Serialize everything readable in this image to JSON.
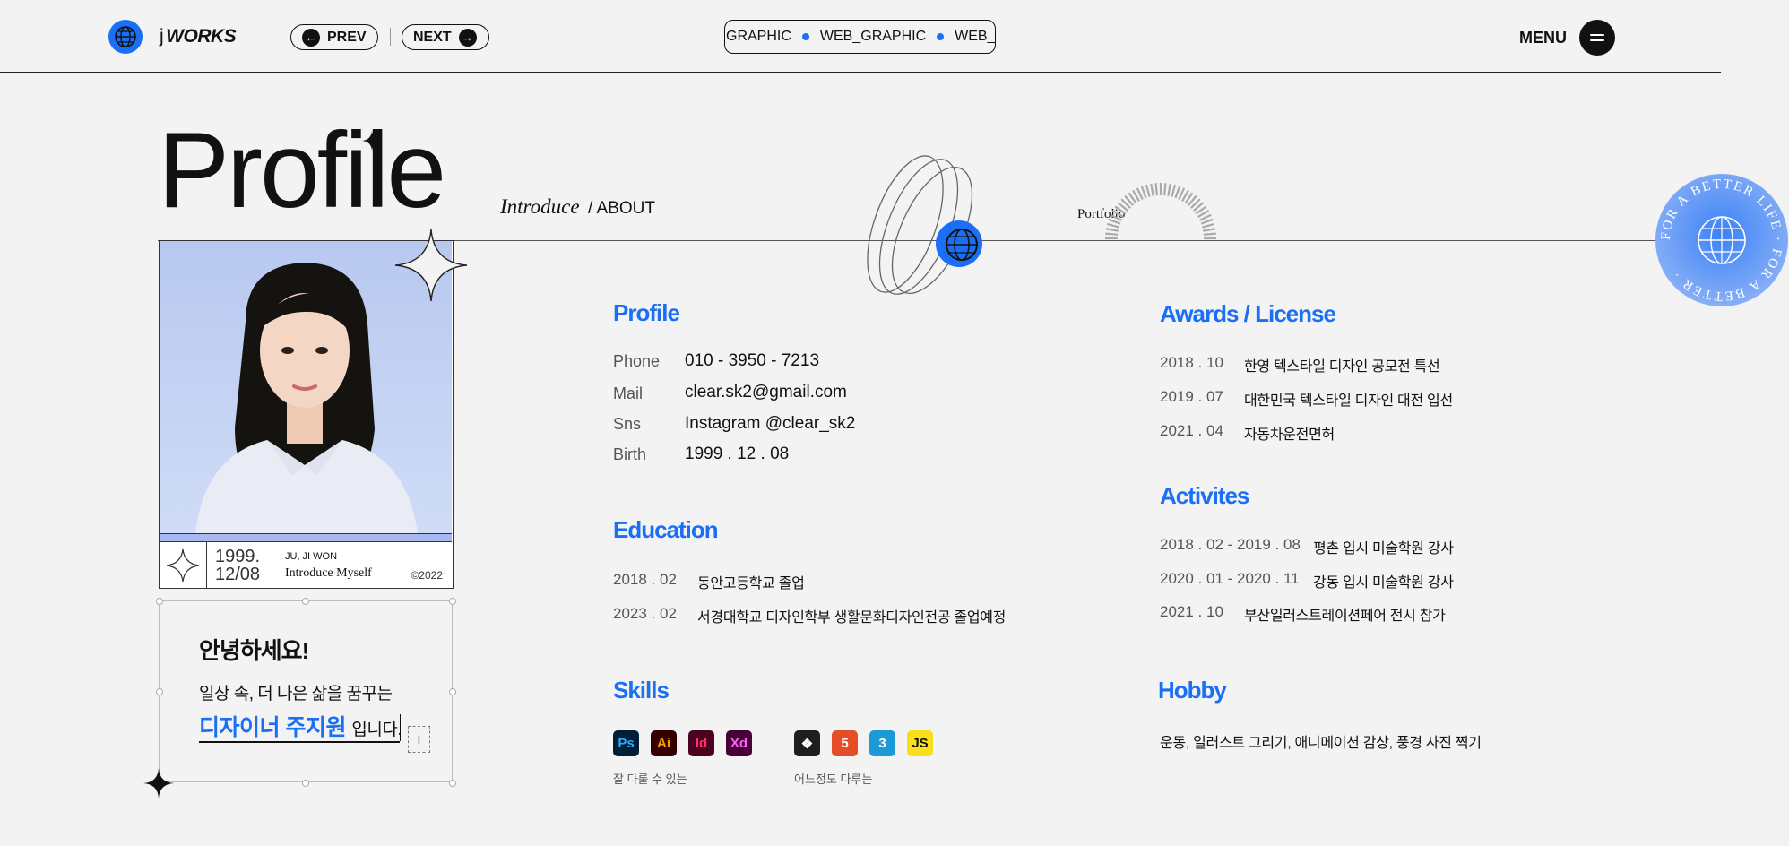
{
  "header": {
    "brand_j": "j",
    "brand_works": "WORKS",
    "prev_label": "PREV",
    "next_label": "NEXT",
    "categories": [
      "GRAPHIC",
      "WEB_GRAPHIC",
      "WEB_GR/"
    ],
    "menu_label": "MENU"
  },
  "hero": {
    "title": "Profile",
    "introduce": "Introduce",
    "about": "/ ABOUT",
    "portfolio": "Portfolio"
  },
  "badge": {
    "ring_text": "FOR A BETTER LIFE · FOR A BETTER · "
  },
  "photo_card": {
    "date_line1": "1999.",
    "date_line2": "12/08",
    "name": "JU, JI WON",
    "intro": "Introduce Myself",
    "copyright": "©2022"
  },
  "greeting": {
    "title": "안녕하세요!",
    "line1": "일상 속, 더 나은 삶을 꿈꾸는",
    "highlight": "디자이너 주지원",
    "suffix": "입니다.",
    "cursor_glyph": "I"
  },
  "profile": {
    "title": "Profile",
    "rows": [
      {
        "label": "Phone",
        "value": "010 - 3950 - 7213"
      },
      {
        "label": "Mail",
        "value": "clear.sk2@gmail.com"
      },
      {
        "label": "Sns",
        "value": "Instagram @clear_sk2"
      },
      {
        "label": "Birth",
        "value": "1999 . 12 . 08"
      }
    ]
  },
  "education": {
    "title": "Education",
    "rows": [
      {
        "year": "2018 . 02",
        "text": "동안고등학교 졸업"
      },
      {
        "year": "2023 . 02",
        "text": "서경대학교 디자인학부 생활문화디자인전공 졸업예정"
      }
    ]
  },
  "skills": {
    "title": "Skills",
    "caption_good": "잘 다룰 수 있는",
    "caption_some": "어느정도 다루는",
    "good": [
      {
        "label": "Ps",
        "bg": "#001e36",
        "fg": "#31a8ff"
      },
      {
        "label": "Ai",
        "bg": "#330000",
        "fg": "#ff9a00"
      },
      {
        "label": "Id",
        "bg": "#49021f",
        "fg": "#ff3366"
      },
      {
        "label": "Xd",
        "bg": "#470137",
        "fg": "#ff61f6"
      }
    ],
    "some": [
      {
        "label": "figma",
        "bg": "#1e1e1e",
        "fg": "#ffffff"
      },
      {
        "label": "5",
        "bg": "#e44d26",
        "fg": "#ffffff"
      },
      {
        "label": "3",
        "bg": "#1b9ad6",
        "fg": "#ffffff"
      },
      {
        "label": "JS",
        "bg": "#f7df1e",
        "fg": "#111111"
      }
    ]
  },
  "awards": {
    "title": "Awards / License",
    "rows": [
      {
        "year": "2018 . 10",
        "text": "한영 텍스타일 디자인 공모전 특선"
      },
      {
        "year": "2019 . 07",
        "text": "대한민국 텍스타일 디자인 대전 입선"
      },
      {
        "year": "2021 . 04",
        "text": "자동차운전면허"
      }
    ]
  },
  "activities": {
    "title": "Activites",
    "rows": [
      {
        "year": "2018 . 02 - 2019 . 08",
        "text": "평촌 입시 미술학원 강사"
      },
      {
        "year": "2020 . 01 - 2020 . 11",
        "text": "강동 입시 미술학원 강사"
      },
      {
        "year": "2021 . 10",
        "text": "부산일러스트레이션페어 전시 참가"
      }
    ]
  },
  "hobby": {
    "title": "Hobby",
    "text": "운동, 일러스트 그리기, 애니메이션 감상, 풍경 사진 찍기"
  },
  "colors": {
    "accent": "#1a6ff5",
    "background": "#f3f3f3",
    "ink": "#111111"
  }
}
